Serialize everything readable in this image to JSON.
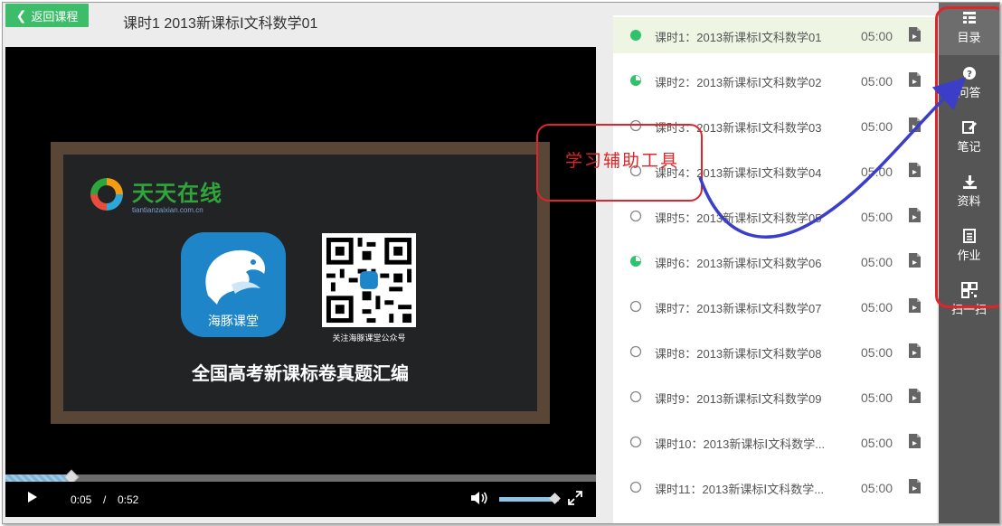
{
  "header": {
    "back_label": "返回课程",
    "title": "课时1  2013新课标Ⅰ文科数学01"
  },
  "video": {
    "logo_main": "天天在线",
    "logo_sub": "tiantianzaixian.com.cn",
    "app_label": "海豚课堂",
    "qr_caption": "关注海豚课堂公众号",
    "board_caption": "全国高考新课标卷真题汇编",
    "current_time": "0:05",
    "separator": "/",
    "duration": "0:52",
    "progress": 0.11,
    "volume": 0.93
  },
  "lessons": [
    {
      "title": "课时1：2013新课标Ⅰ文科数学01",
      "duration": "05:00",
      "status": "current"
    },
    {
      "title": "课时2：2013新课标Ⅰ文科数学02",
      "duration": "05:00",
      "status": "partial"
    },
    {
      "title": "课时3：2013新课标Ⅰ文科数学03",
      "duration": "05:00",
      "status": "none"
    },
    {
      "title": "课时4：2013新课标Ⅰ文科数学04",
      "duration": "05:00",
      "status": "none"
    },
    {
      "title": "课时5：2013新课标Ⅰ文科数学05",
      "duration": "05:00",
      "status": "none"
    },
    {
      "title": "课时6：2013新课标Ⅰ文科数学06",
      "duration": "05:00",
      "status": "partial"
    },
    {
      "title": "课时7：2013新课标Ⅰ文科数学07",
      "duration": "05:00",
      "status": "none"
    },
    {
      "title": "课时8：2013新课标Ⅰ文科数学08",
      "duration": "05:00",
      "status": "none"
    },
    {
      "title": "课时9：2013新课标Ⅰ文科数学09",
      "duration": "05:00",
      "status": "none"
    },
    {
      "title": "课时10：2013新课标Ⅰ文科数学...",
      "duration": "05:00",
      "status": "none"
    },
    {
      "title": "课时11：2013新课标Ⅰ文科数学...",
      "duration": "05:00",
      "status": "none"
    }
  ],
  "rail": [
    {
      "label": "目录",
      "icon": "list-icon",
      "active": true
    },
    {
      "label": "问答",
      "icon": "question-icon"
    },
    {
      "label": "笔记",
      "icon": "edit-icon"
    },
    {
      "label": "资料",
      "icon": "download-icon"
    },
    {
      "label": "作业",
      "icon": "homework-icon"
    },
    {
      "label": "扫一扫",
      "icon": "qrcode-icon"
    }
  ],
  "annotation": {
    "label": "学习辅助工具"
  },
  "colors": {
    "accent_green": "#3dbd6a",
    "status_green": "#2ec36b",
    "annotation_red": "#e0242a",
    "arrow_blue": "#3b3fc8",
    "rail_bg": "#555555"
  }
}
